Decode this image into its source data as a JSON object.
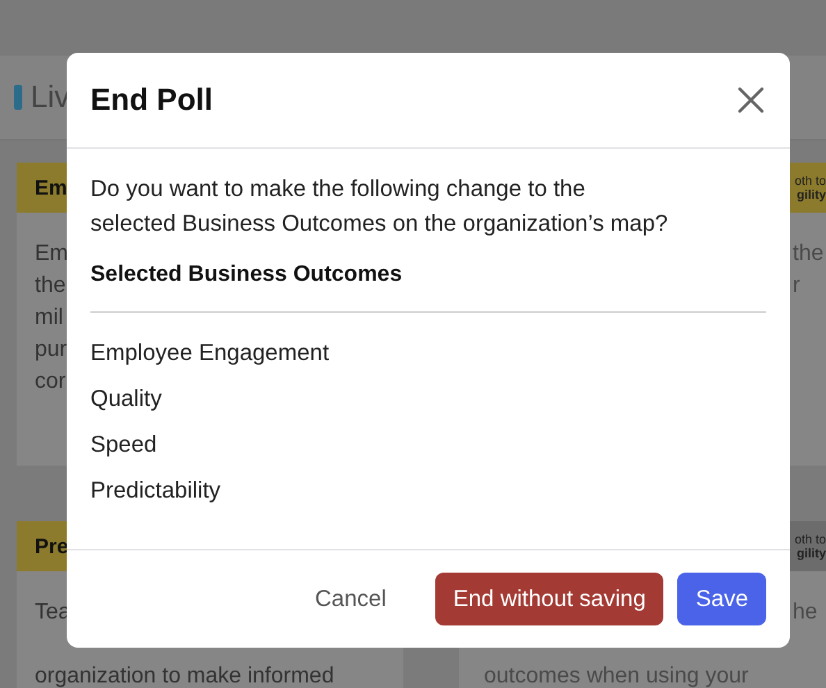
{
  "background": {
    "header": "Liv",
    "left_cards": [
      {
        "kind": "gold",
        "title": "Em",
        "lines": [
          "Em",
          "the",
          "mil",
          "pur",
          "cor"
        ]
      },
      {
        "kind": "gold",
        "title": "Pre",
        "lines": [
          "Tea",
          {
            "text": "organization to make informed",
            "gap_before": true
          }
        ]
      }
    ],
    "right_cards": [
      {
        "kind": "gold",
        "logo": [
          "oth to",
          "gility"
        ],
        "lines": [
          {
            "text": "the",
            "kind": "tail"
          },
          {
            "text": "r",
            "kind": "tail"
          }
        ]
      },
      {
        "kind": "grey",
        "logo": [
          "oth to",
          "gility"
        ],
        "lines": [
          {
            "text": "he",
            "kind": "tail"
          },
          {
            "text": "outcomes when using your",
            "kind": "full",
            "gap_before": true
          }
        ]
      }
    ]
  },
  "dialog": {
    "title": "End Poll",
    "question": "Do you want to make the following change to the selected Business Outcomes on the organization’s map?",
    "list_heading": "Selected Business Outcomes",
    "outcomes": [
      "Employee Engagement",
      "Quality",
      "Speed",
      "Predictability"
    ],
    "buttons": [
      {
        "kind": "text",
        "label": "Cancel"
      },
      {
        "kind": "danger",
        "label": "End without saving"
      },
      {
        "kind": "primary",
        "label": "Save"
      }
    ]
  }
}
